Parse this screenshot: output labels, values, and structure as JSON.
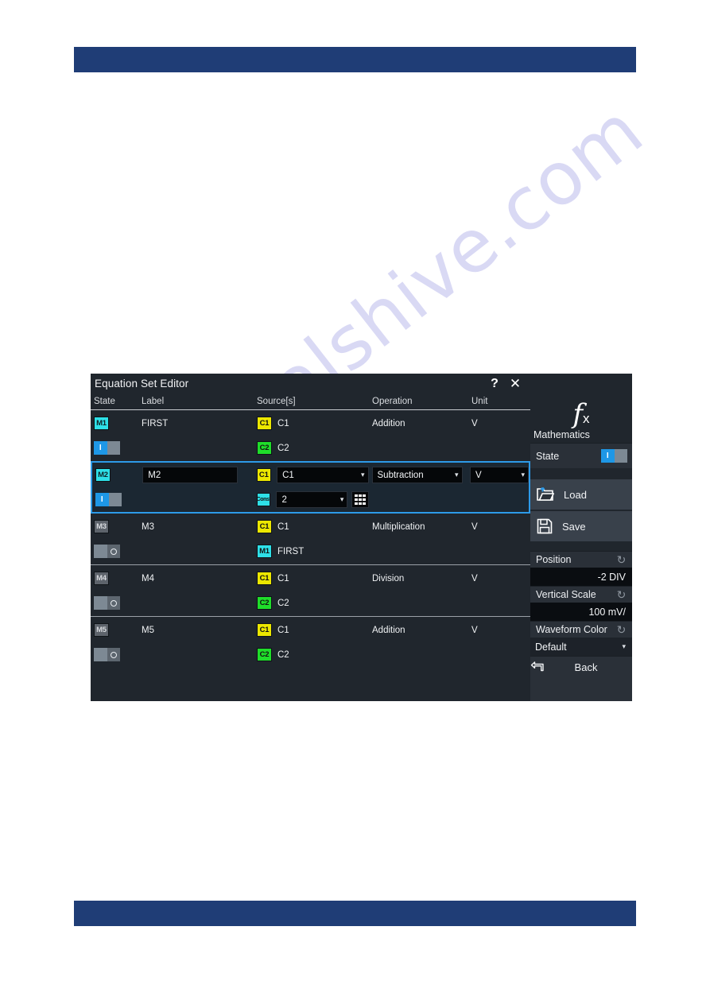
{
  "page": {
    "top_bar_color": "#1f3d76",
    "bottom_bar_color": "#1f3d76",
    "watermark": "manualshive.com"
  },
  "dialog": {
    "title": "Equation Set Editor",
    "help_label": "?",
    "close_label": "✕",
    "columns": [
      "State",
      "Label",
      "Source[s]",
      "Operation",
      "Unit"
    ],
    "rows": [
      {
        "state_badge": "M1",
        "state_on": true,
        "toggle_label": "I",
        "label": "FIRST",
        "sources": [
          {
            "badge": "C1",
            "badge_kind": "c1",
            "text": "C1"
          },
          {
            "badge": "C2",
            "badge_kind": "c2",
            "text": "C2"
          }
        ],
        "operation": "Addition",
        "unit": "V",
        "selected": false
      },
      {
        "state_badge": "M2",
        "state_on": true,
        "toggle_label": "I",
        "label": "M2",
        "sources": [
          {
            "badge": "C1",
            "badge_kind": "c1",
            "text": "C1"
          },
          {
            "badge": "Const",
            "badge_kind": "cst",
            "text": "2"
          }
        ],
        "operation": "Subtraction",
        "unit": "V",
        "selected": true
      },
      {
        "state_badge": "M3",
        "state_on": false,
        "toggle_label": "O",
        "label": "M3",
        "sources": [
          {
            "badge": "C1",
            "badge_kind": "c1",
            "text": "C1"
          },
          {
            "badge": "M1",
            "badge_kind": "m1",
            "text": "FIRST"
          }
        ],
        "operation": "Multiplication",
        "unit": "V",
        "selected": false
      },
      {
        "state_badge": "M4",
        "state_on": false,
        "toggle_label": "O",
        "label": "M4",
        "sources": [
          {
            "badge": "C1",
            "badge_kind": "c1",
            "text": "C1"
          },
          {
            "badge": "C2",
            "badge_kind": "c2",
            "text": "C2"
          }
        ],
        "operation": "Division",
        "unit": "V",
        "selected": false
      },
      {
        "state_badge": "M5",
        "state_on": false,
        "toggle_label": "O",
        "label": "M5",
        "sources": [
          {
            "badge": "C1",
            "badge_kind": "c1",
            "text": "C1"
          },
          {
            "badge": "C2",
            "badge_kind": "c2",
            "text": "C2"
          }
        ],
        "operation": "Addition",
        "unit": "V",
        "selected": false
      }
    ]
  },
  "sidebar": {
    "icon": "fx-icon",
    "title": "Mathematics",
    "state_label": "State",
    "state_on": true,
    "state_toggle_label": "I",
    "load_label": "Load",
    "save_label": "Save",
    "position_label": "Position",
    "position_value": "-2 DIV",
    "vertical_scale_label": "Vertical Scale",
    "vertical_scale_value": "100 mV/",
    "waveform_color_label": "Waveform Color",
    "waveform_color_value": "Default",
    "back_label": "Back"
  },
  "colors": {
    "accent_blue": "#2d9ae8",
    "cyan": "#2ee0e8",
    "yellow": "#ece700",
    "green": "#1fdd2a",
    "panel": "#20262d",
    "sidebar": "#2a3038"
  }
}
